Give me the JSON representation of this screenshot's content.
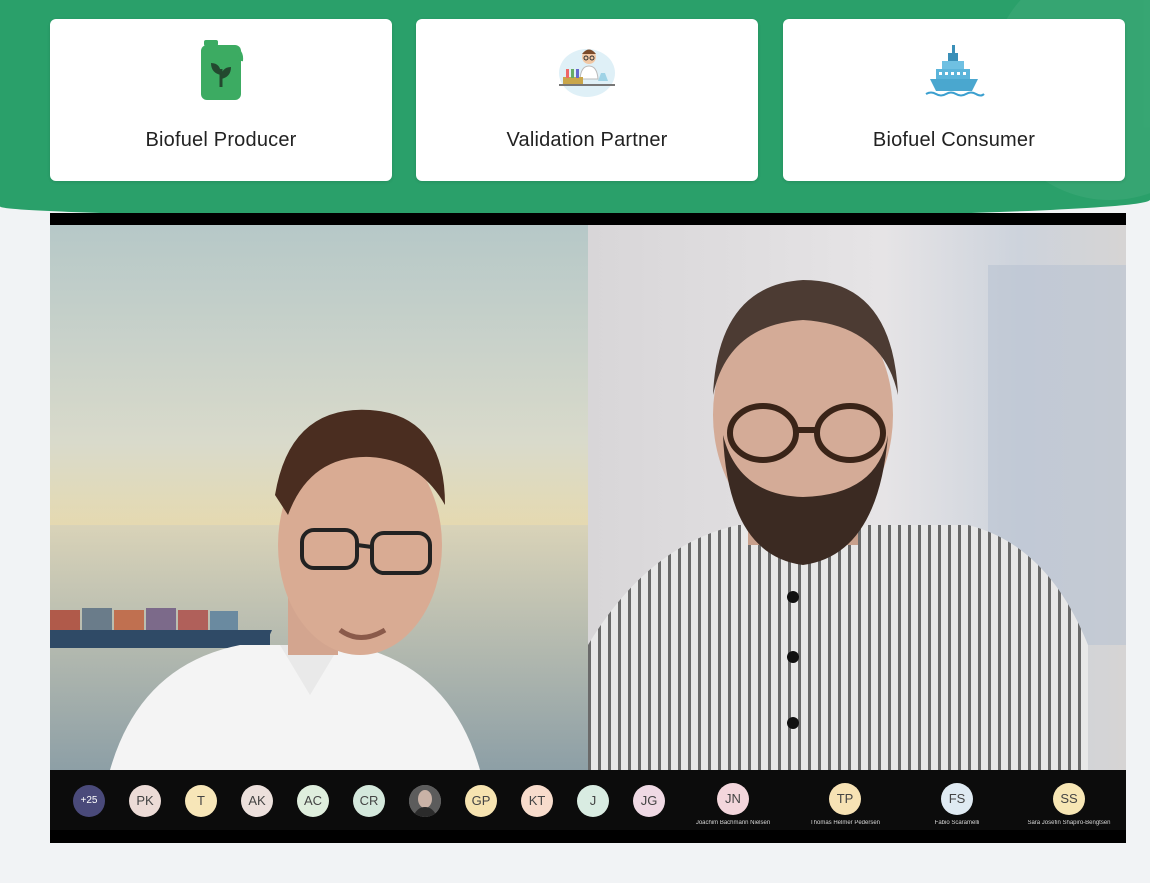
{
  "cards": [
    {
      "label": "Biofuel Producer",
      "icon": "jerrycan-leaf-icon"
    },
    {
      "label": "Validation Partner",
      "icon": "scientist-lab-icon"
    },
    {
      "label": "Biofuel Consumer",
      "icon": "ship-icon"
    }
  ],
  "participants_strip": {
    "more_count": "+25",
    "initials": [
      "PK",
      "T",
      "AK",
      "AC",
      "CR",
      "GP",
      "KT",
      "J",
      "JG"
    ],
    "named": [
      {
        "initials": "JN",
        "name": "Joachim Bachmann Nielsen"
      },
      {
        "initials": "TP",
        "name": "Thomas Helmer Pedersen"
      },
      {
        "initials": "FS",
        "name": "Fabio Scaramelli"
      },
      {
        "initials": "SS",
        "name": "Sara Josefin Shapiro-Bengtsen"
      }
    ]
  },
  "colors": {
    "brand_green": "#2aa06a",
    "card_bg": "#ffffff",
    "page_bg": "#f1f3f5"
  }
}
